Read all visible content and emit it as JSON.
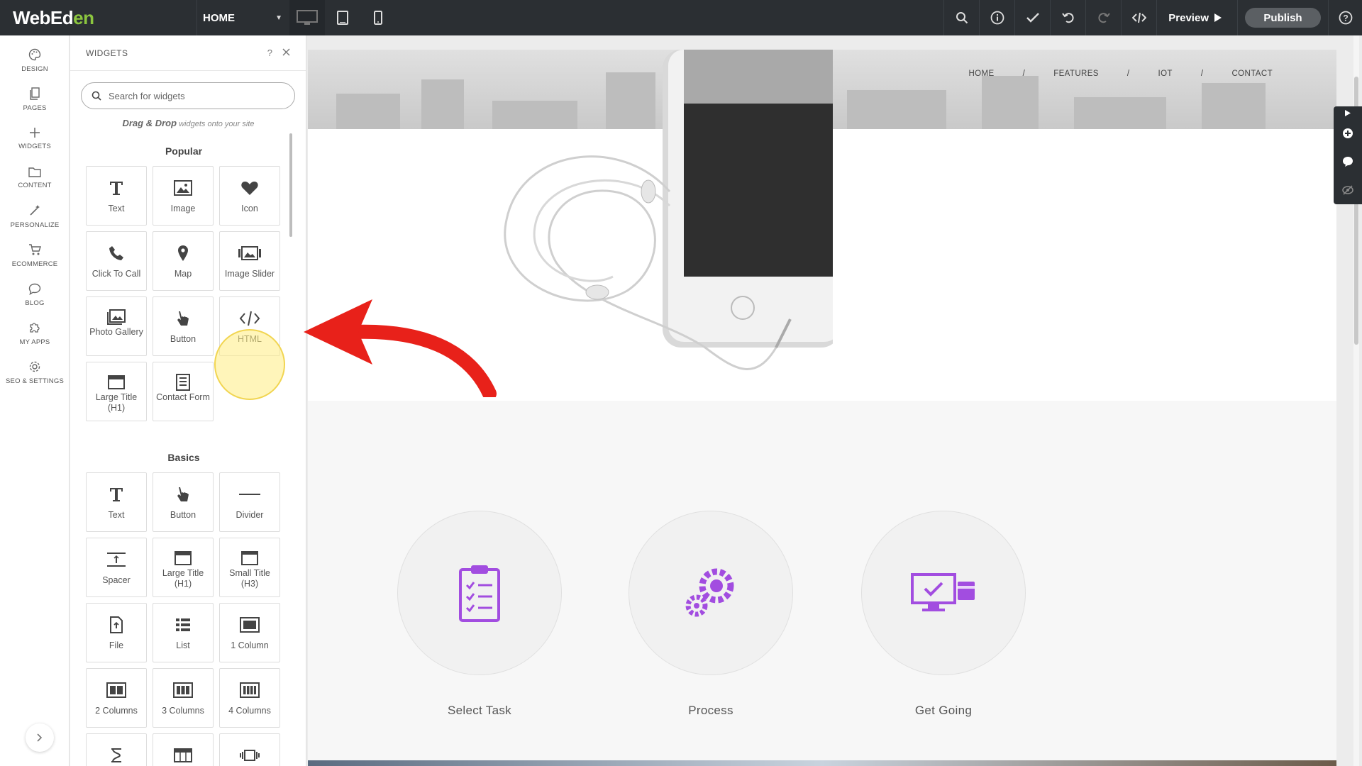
{
  "app": {
    "logo_main": "WebEd",
    "logo_accent": "en"
  },
  "topbar": {
    "page_selector": "HOME",
    "preview_label": "Preview",
    "publish_label": "Publish"
  },
  "rail": {
    "items": [
      {
        "label": "DESIGN",
        "icon": "palette-icon"
      },
      {
        "label": "PAGES",
        "icon": "pages-icon"
      },
      {
        "label": "WIDGETS",
        "icon": "plus-icon"
      },
      {
        "label": "CONTENT",
        "icon": "folder-icon"
      },
      {
        "label": "PERSONALIZE",
        "icon": "wand-icon"
      },
      {
        "label": "ECOMMERCE",
        "icon": "cart-icon"
      },
      {
        "label": "BLOG",
        "icon": "chat-bubble-icon"
      },
      {
        "label": "MY APPS",
        "icon": "puzzle-icon"
      },
      {
        "label": "SEO & SETTINGS",
        "icon": "gear-icon"
      }
    ]
  },
  "panel": {
    "title": "WIDGETS",
    "help": "?",
    "search_placeholder": "Search for widgets",
    "hint_strong": "Drag & Drop",
    "hint_rest": " widgets onto your site",
    "popular_title": "Popular",
    "basics_title": "Basics",
    "popular": [
      {
        "label": "Text",
        "icon": "text-icon"
      },
      {
        "label": "Image",
        "icon": "image-icon"
      },
      {
        "label": "Icon",
        "icon": "heart-icon"
      },
      {
        "label": "Click To Call",
        "icon": "phone-icon"
      },
      {
        "label": "Map",
        "icon": "map-pin-icon"
      },
      {
        "label": "Image Slider",
        "icon": "image-slider-icon"
      },
      {
        "label": "Photo Gallery",
        "icon": "photo-gallery-icon"
      },
      {
        "label": "Button",
        "icon": "pointer-hand-icon"
      },
      {
        "label": "HTML",
        "icon": "code-icon"
      },
      {
        "label": "Large Title (H1)",
        "icon": "large-title-icon"
      },
      {
        "label": "Contact Form",
        "icon": "contact-form-icon"
      }
    ],
    "basics": [
      {
        "label": "Text",
        "icon": "text-icon"
      },
      {
        "label": "Button",
        "icon": "pointer-hand-icon"
      },
      {
        "label": "Divider",
        "icon": "divider-icon"
      },
      {
        "label": "Spacer",
        "icon": "spacer-icon"
      },
      {
        "label": "Large Title (H1)",
        "icon": "large-title-icon"
      },
      {
        "label": "Small Title (H3)",
        "icon": "small-title-icon"
      },
      {
        "label": "File",
        "icon": "file-icon"
      },
      {
        "label": "List",
        "icon": "list-icon"
      },
      {
        "label": "1 Column",
        "icon": "one-column-icon"
      },
      {
        "label": "2 Columns",
        "icon": "two-columns-icon"
      },
      {
        "label": "3 Columns",
        "icon": "three-columns-icon"
      },
      {
        "label": "4 Columns",
        "icon": "four-columns-icon"
      }
    ]
  },
  "site": {
    "nav": [
      "HOME",
      "/",
      "FEATURES",
      "/",
      "IOT",
      "/",
      "CONTACT"
    ],
    "features": [
      {
        "label": "Select Task",
        "icon": "clipboard-checklist-icon"
      },
      {
        "label": "Process",
        "icon": "gears-icon"
      },
      {
        "label": "Get Going",
        "icon": "monitor-check-icon"
      }
    ]
  },
  "colors": {
    "topbar": "#2b2f33",
    "accent_green": "#8cc63f",
    "feature_purple": "#a24de0",
    "arrow_red": "#e8211a",
    "highlight_yellow": "#f1d551"
  }
}
